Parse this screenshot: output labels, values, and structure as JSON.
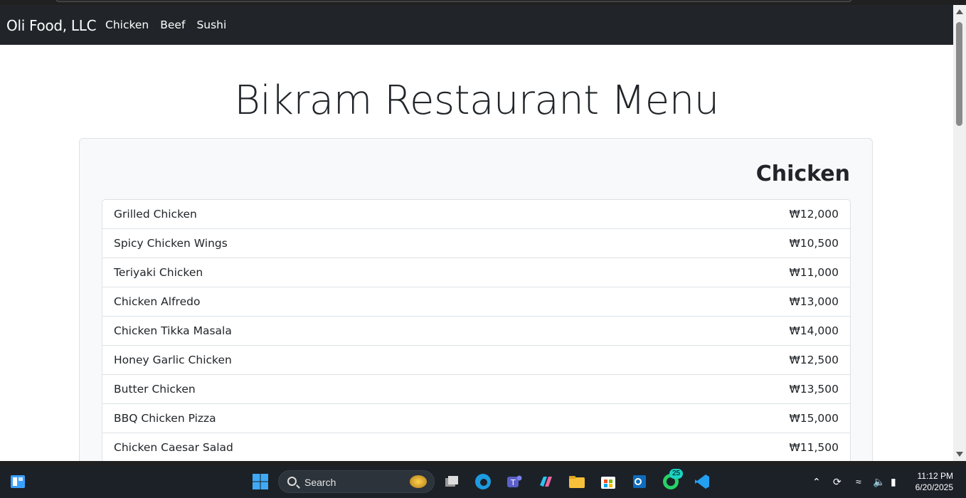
{
  "navbar": {
    "brand": "Oli Food, LLC",
    "links": [
      "Chicken",
      "Beef",
      "Sushi"
    ]
  },
  "page": {
    "title": "Bikram Restaurant Menu"
  },
  "section": {
    "title": "Chicken",
    "items": [
      {
        "name": "Grilled Chicken",
        "price": "₩12,000"
      },
      {
        "name": "Spicy Chicken Wings",
        "price": "₩10,500"
      },
      {
        "name": "Teriyaki Chicken",
        "price": "₩11,000"
      },
      {
        "name": "Chicken Alfredo",
        "price": "₩13,000"
      },
      {
        "name": "Chicken Tikka Masala",
        "price": "₩14,000"
      },
      {
        "name": "Honey Garlic Chicken",
        "price": "₩12,500"
      },
      {
        "name": "Butter Chicken",
        "price": "₩13,500"
      },
      {
        "name": "BBQ Chicken Pizza",
        "price": "₩15,000"
      },
      {
        "name": "Chicken Caesar Salad",
        "price": "₩11,500"
      }
    ]
  },
  "taskbar": {
    "search_label": "Search",
    "whatsapp_badge": "25",
    "time": "11:12 PM",
    "date": "6/20/2025"
  }
}
